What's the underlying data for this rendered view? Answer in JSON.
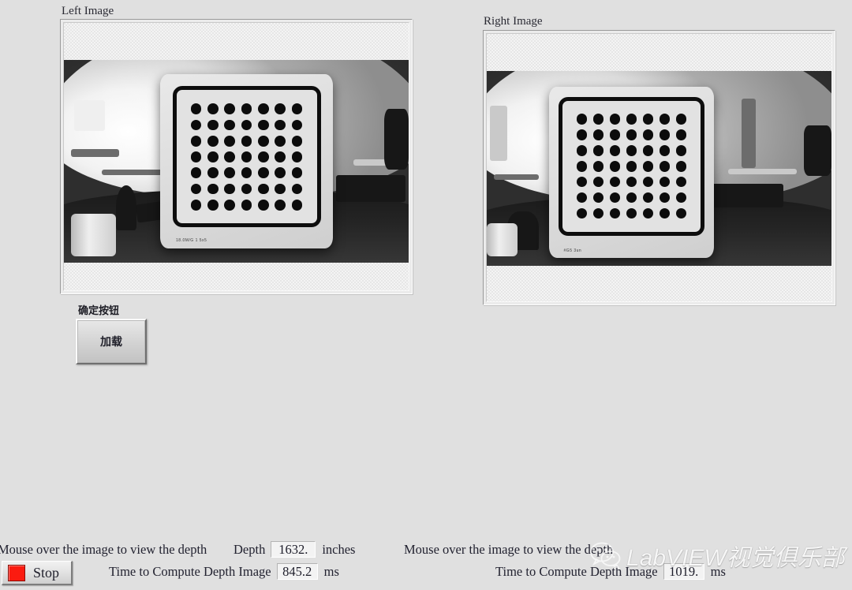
{
  "window": {
    "background_color": "#e0e0e0"
  },
  "panels": {
    "left": {
      "label": "Left Image",
      "board_caption": "18.0M/G 1 5x5"
    },
    "right": {
      "label": "Right Image",
      "board_caption": "#G5 3un"
    }
  },
  "controls": {
    "load_button_caption": "确定按钮",
    "load_button_label": "加载",
    "stop_button_label": "Stop",
    "stop_led_color": "#fb1b10"
  },
  "readouts": {
    "left": {
      "hint": "Mouse over the image to view the depth",
      "depth_label": "Depth",
      "depth_value": "1632.",
      "depth_unit": "inches",
      "time_label": "Time to Compute Depth Image",
      "time_value": "845.2",
      "time_unit": "ms"
    },
    "right": {
      "hint": "Mouse over the image to view the depth",
      "time_label": "Time to Compute Depth Image",
      "time_value": "1019.",
      "time_unit": "ms"
    }
  },
  "watermark": {
    "text": "LabVIEW视觉俱乐部",
    "icon": "wechat-icon"
  },
  "calibration_grid": {
    "rows": 7,
    "columns": 7
  }
}
